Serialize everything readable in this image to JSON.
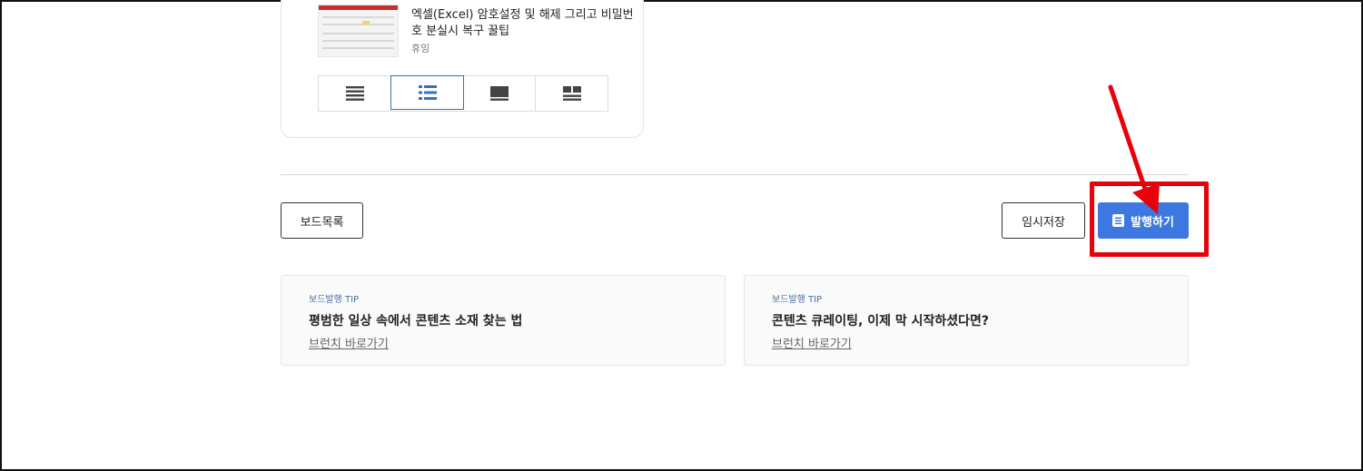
{
  "post_card": {
    "title": "엑셀(Excel) 암호설정 및 해제 그리고 비밀번호 분실시 복구 꿀팁",
    "author": "휴잉",
    "thumbnail_icon": "excel-spreadsheet-thumbnail"
  },
  "view_switch": {
    "options": [
      {
        "icon": "text-list-icon",
        "active": false
      },
      {
        "icon": "bullet-list-icon",
        "active": true
      },
      {
        "icon": "card-view-icon",
        "active": false
      },
      {
        "icon": "grid-view-icon",
        "active": false
      }
    ]
  },
  "actions": {
    "board_list_label": "보드목록",
    "save_draft_label": "임시저장",
    "publish_label": "발행하기",
    "publish_icon": "document-icon",
    "publish_color": "#3d78e0"
  },
  "annotation": {
    "color": "#e8000b"
  },
  "tips": [
    {
      "label": "보드발행 TIP",
      "title": "평범한 일상 속에서 콘텐츠 소재 찾는 법",
      "link": "브런치 바로가기"
    },
    {
      "label": "보드발행 TIP",
      "title": "콘텐츠 큐레이팅, 이제 막 시작하셨다면?",
      "link": "브런치 바로가기"
    }
  ]
}
